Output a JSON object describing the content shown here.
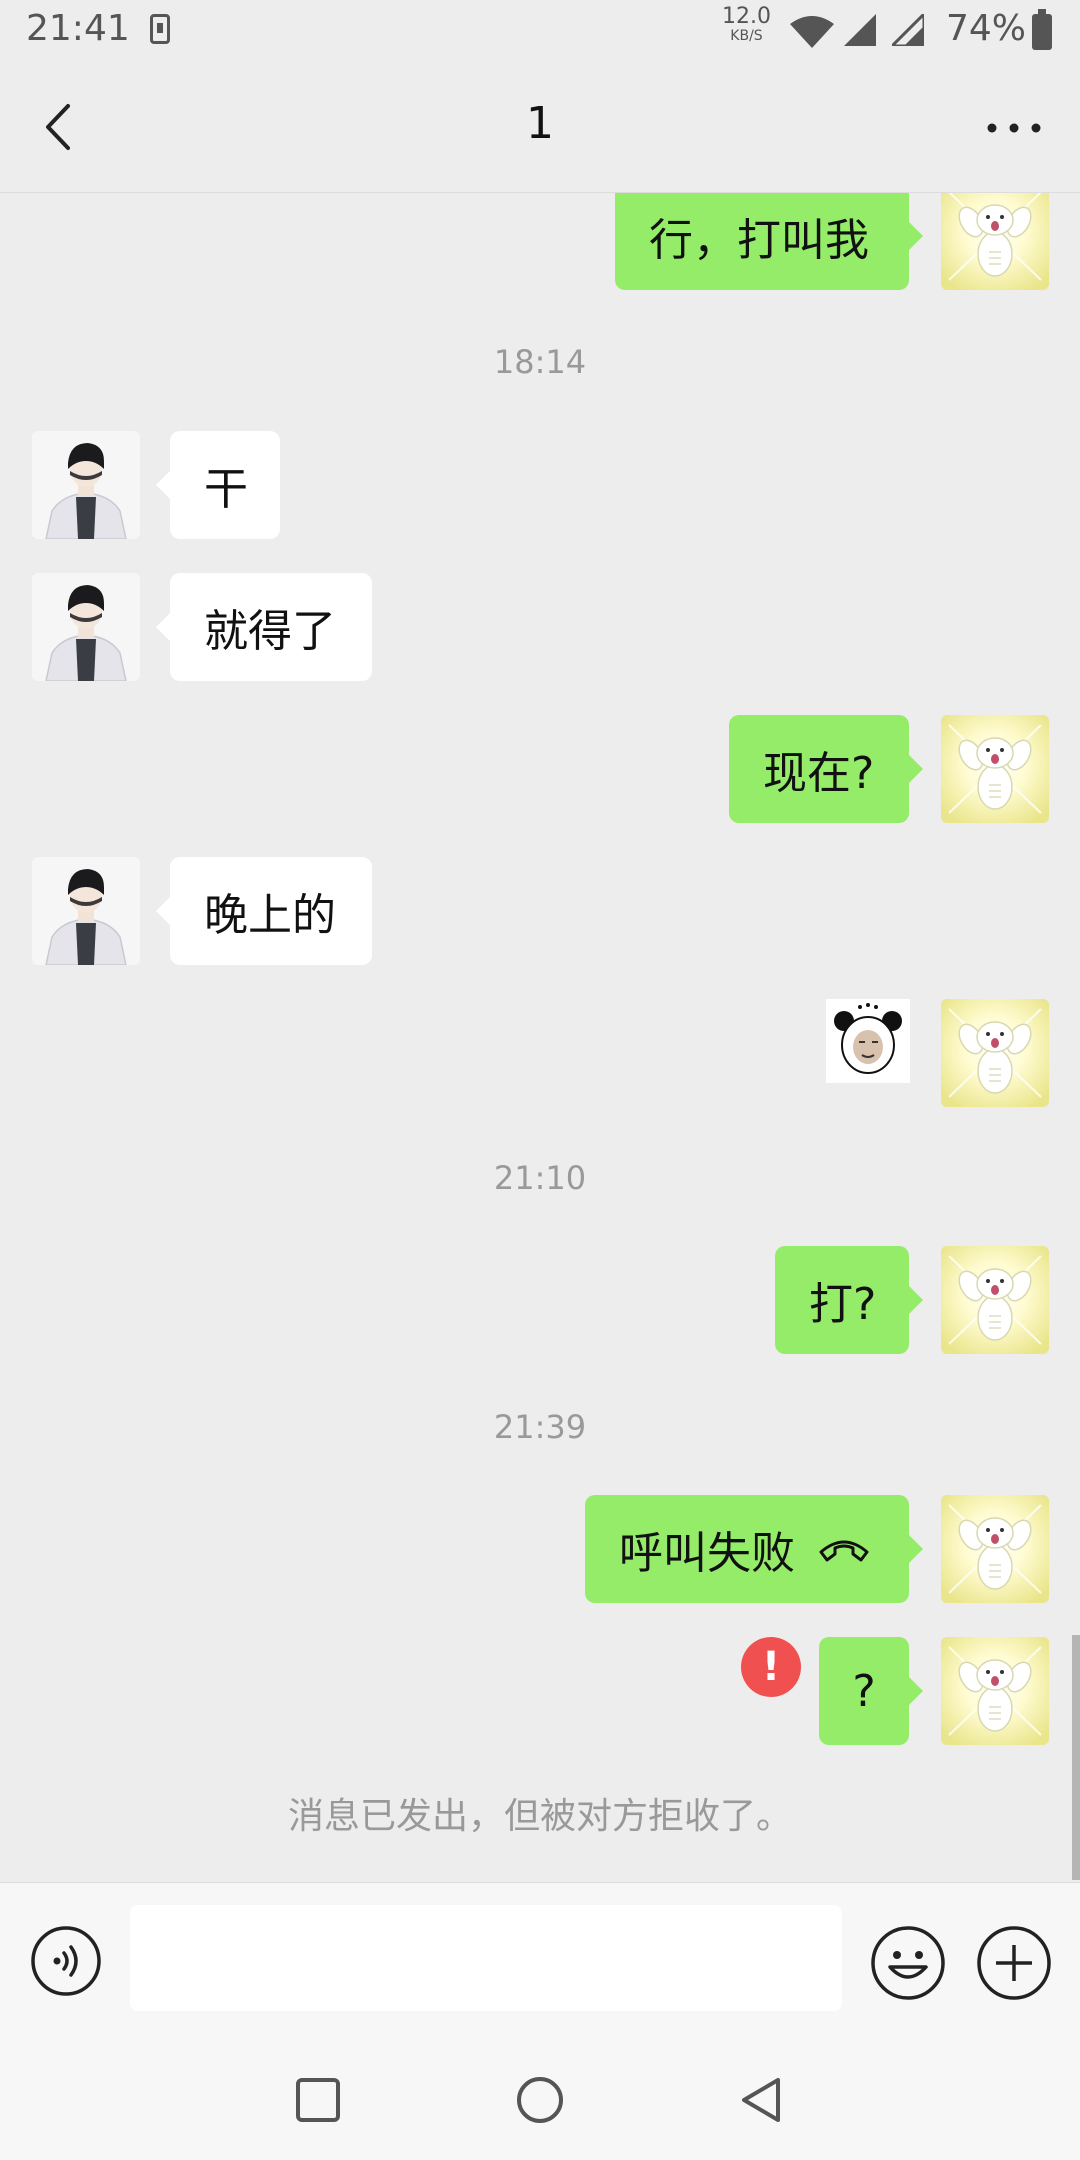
{
  "status_bar": {
    "time": "21:41",
    "net_speed_value": "12.0",
    "net_speed_unit": "KB/S",
    "battery": "74%"
  },
  "header": {
    "title": "1",
    "back_icon": "chevron-left-icon",
    "more_icon": "more-horizontal-icon"
  },
  "messages": [
    {
      "side": "out",
      "type": "text",
      "text": "行，打叫我"
    },
    {
      "type": "timestamp",
      "text": "18:14"
    },
    {
      "side": "in",
      "type": "text",
      "text": "干"
    },
    {
      "side": "in",
      "type": "text",
      "text": "就得了"
    },
    {
      "side": "out",
      "type": "text",
      "text": "现在?"
    },
    {
      "side": "in",
      "type": "text",
      "text": "晚上的"
    },
    {
      "side": "out",
      "type": "sticker",
      "icon": "panda-meme-sticker"
    },
    {
      "type": "timestamp",
      "text": "21:10"
    },
    {
      "side": "out",
      "type": "text",
      "text": "打?"
    },
    {
      "type": "timestamp",
      "text": "21:39"
    },
    {
      "side": "out",
      "type": "call",
      "text": "呼叫失败",
      "icon": "hang-up-phone-icon"
    },
    {
      "side": "out",
      "type": "text",
      "text": "?",
      "error": "!"
    },
    {
      "type": "system",
      "text": "消息已发出，但被对方拒收了。"
    }
  ],
  "input_bar": {
    "voice_icon": "voice-input-icon",
    "input_value": "",
    "emoji_icon": "emoji-icon",
    "plus_icon": "plus-circle-icon"
  },
  "nav_bar": {
    "icons": [
      "square-recents-icon",
      "circle-home-icon",
      "triangle-back-icon"
    ]
  },
  "colors": {
    "background": "#ededed",
    "outgoing_bubble": "#95ec69",
    "incoming_bubble": "#ffffff",
    "error": "#f05050"
  }
}
